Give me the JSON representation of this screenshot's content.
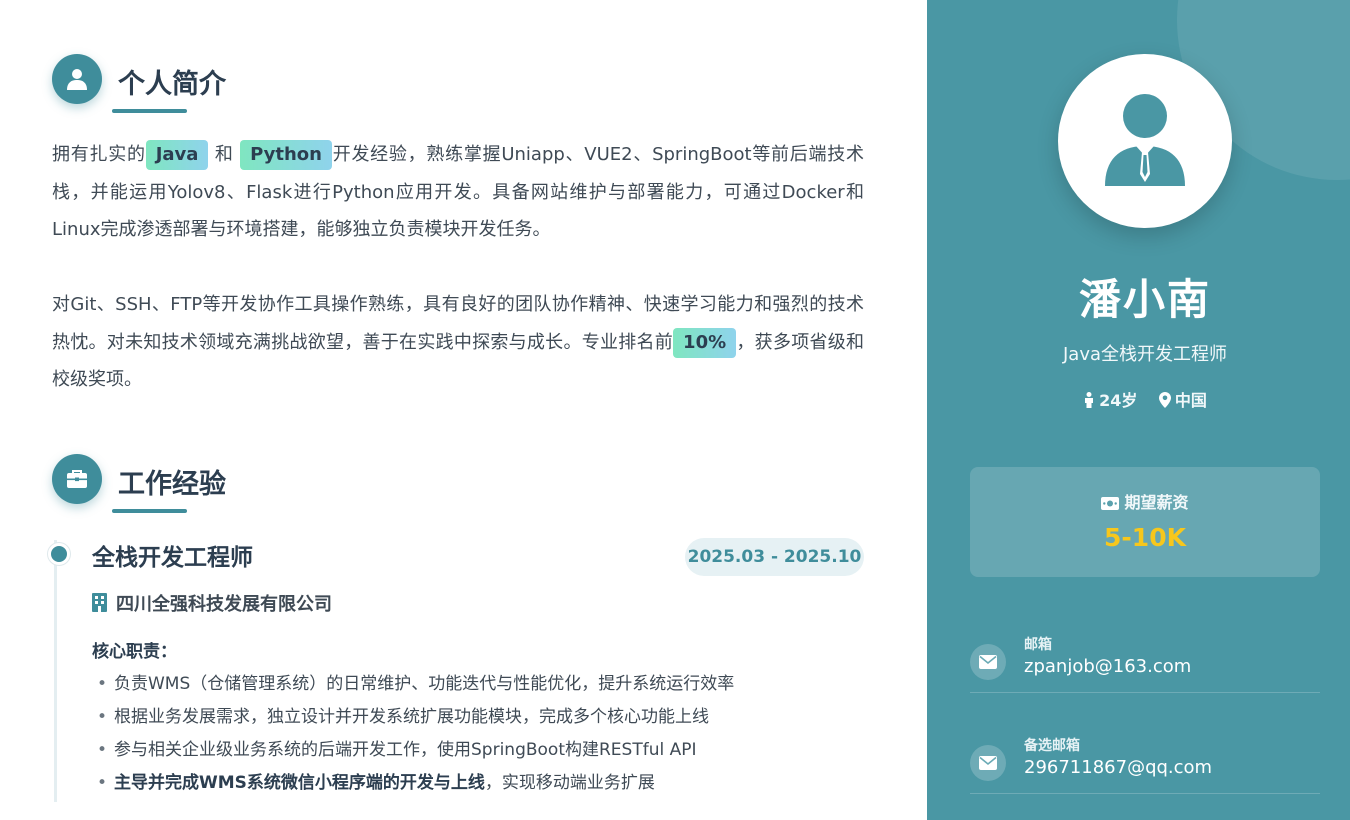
{
  "profile_section": {
    "title": "个人简介",
    "icon": "user-icon",
    "para1": {
      "t1": "拥有扎实的",
      "hl1": "Java",
      "t2": "和",
      "hl2": "Python",
      "t3": "开发经验，熟练掌握Uniapp、VUE2、SpringBoot等前后端技术栈，并能运用Yolov8、Flask进行Python应用开发。具备网站维护与部署能力，可通过Docker和Linux完成渗透部署与环境搭建，能够独立负责模块开发任务。"
    },
    "para2": {
      "t1": "对Git、SSH、FTP等开发协作工具操作熟练，具有良好的团队协作精神、快速学习能力和强烈的技术热忱。对未知技术领域充满挑战欲望，善于在实践中探索与成长。专业排名前",
      "hl1": "10%",
      "t2": "，获多项省级和校级奖项。"
    },
    "highlight_gradient": [
      "#7fe6c0",
      "#8fd3ec"
    ]
  },
  "experience_section": {
    "title": "工作经验",
    "icon": "briefcase-icon",
    "job": {
      "title": "全栈开发工程师",
      "date": "2025.03 - 2025.10",
      "company_icon": "building-icon",
      "company": "四川全强科技发展有限公司",
      "duties_label": "核心职责：",
      "bullet": "•",
      "duties": [
        "负责WMS（仓储管理系统）的日常维护、功能迭代与性能优化，提升系统运行效率",
        "根据业务发展需求，独立设计并开发系统扩展功能模块，完成多个核心功能上线",
        "参与相关企业级业务系统的后端开发工作，使用SpringBoot构建RESTful API"
      ],
      "duty4": {
        "bold": "主导并完成WMS系统微信小程序端的开发与上线",
        "rest": "，实现移动端业务扩展"
      }
    }
  },
  "sidebar": {
    "avatar_icon": "business-person-icon",
    "name": "潘小南",
    "role": "Java全栈开发工程师",
    "age_icon": "person-icon",
    "age": "24岁",
    "location_icon": "map-pin-icon",
    "location": "中国",
    "salary": {
      "icon": "money-icon",
      "label": "期望薪资",
      "value": "5-10K"
    },
    "contacts": [
      {
        "icon": "envelope-icon",
        "label": "邮箱",
        "value": "zpanjob@163.com"
      },
      {
        "icon": "envelope-icon",
        "label": "备选邮箱",
        "value": "296711867@qq.com"
      }
    ]
  },
  "colors": {
    "accent": "#3f8d9b",
    "sidebar_bg": "#4a97a4",
    "salary_value": "#f7c71c",
    "heading": "#2c3e50",
    "body_text": "#3f4a55"
  }
}
